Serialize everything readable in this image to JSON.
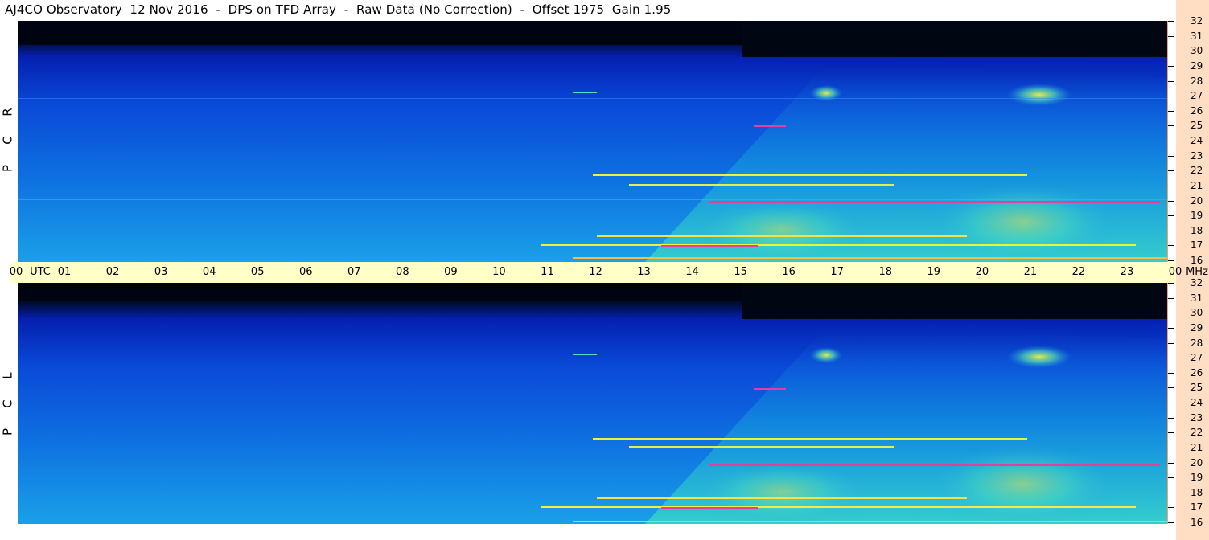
{
  "window": {
    "title": "AJ4CO Observatory  12 Nov 2016  -  DPS on TFD Array  -  Raw Data (No Correction)  -  Offset 1975  Gain 1.95"
  },
  "panels": [
    {
      "id": "rcp",
      "label": "RCP",
      "letters": [
        "R",
        "C",
        "P"
      ]
    },
    {
      "id": "lcp",
      "label": "LCP",
      "letters": [
        "L",
        "C",
        "P"
      ]
    }
  ],
  "time_axis": {
    "unit": "UTC",
    "labels": [
      "00",
      "01",
      "02",
      "03",
      "04",
      "05",
      "06",
      "07",
      "08",
      "09",
      "10",
      "11",
      "12",
      "13",
      "14",
      "15",
      "16",
      "17",
      "18",
      "19",
      "20",
      "21",
      "22",
      "23",
      "00"
    ]
  },
  "freq_axis": {
    "unit": "MHz",
    "labels": [
      "32",
      "31",
      "30",
      "29",
      "28",
      "27",
      "26",
      "25",
      "24",
      "23",
      "22",
      "21",
      "20",
      "19",
      "18",
      "17",
      "16"
    ]
  },
  "colors": {
    "sky_deep": "#000814",
    "sky_blue": "#0a3ad8",
    "sky_light": "#1a8ae8",
    "emission_cyan": "#30e0d0",
    "emission_yellow": "#f0f040",
    "emission_magenta": "#e040a0",
    "time_bar": "#ffffc8",
    "freq_panel": "#ffdec4"
  }
}
